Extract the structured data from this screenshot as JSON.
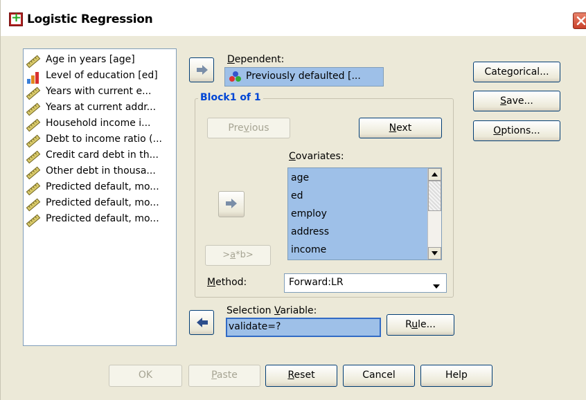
{
  "window": {
    "title": "Logistic Regression"
  },
  "variables": [
    {
      "label": "Age in years [age]",
      "icon": "ruler-icon"
    },
    {
      "label": "Level of education [ed]",
      "icon": "bar-chart-icon"
    },
    {
      "label": "Years with current e...",
      "icon": "ruler-icon"
    },
    {
      "label": "Years at current addr...",
      "icon": "ruler-icon"
    },
    {
      "label": "Household income i...",
      "icon": "ruler-icon"
    },
    {
      "label": "Debt to income ratio (...",
      "icon": "ruler-icon"
    },
    {
      "label": "Credit card debt in th...",
      "icon": "ruler-icon"
    },
    {
      "label": "Other debt in thousa...",
      "icon": "ruler-icon"
    },
    {
      "label": "Predicted default, mo...",
      "icon": "ruler-icon"
    },
    {
      "label": "Predicted default, mo...",
      "icon": "ruler-icon"
    },
    {
      "label": "Predicted default, mo...",
      "icon": "ruler-icon"
    }
  ],
  "dependent": {
    "label_prefix": "D",
    "label_rest": "ependent:",
    "value": "Previously defaulted [..."
  },
  "block": {
    "title": "Block1 of 1",
    "previous_pre": "Pre",
    "previous_u": "v",
    "previous_post": "ious",
    "next_u": "N",
    "next_post": "ext"
  },
  "covariates": {
    "label_u": "C",
    "label_rest": "ovariates:",
    "items": [
      "age",
      "ed",
      "employ",
      "address",
      "income"
    ]
  },
  "interaction": {
    "pre": ">",
    "u": "a",
    "post": "*b>"
  },
  "method": {
    "label_u": "M",
    "label_rest": "ethod:",
    "value": "Forward:LR"
  },
  "selection": {
    "label_pre": "Selection ",
    "label_u": "V",
    "label_rest": "ariable:",
    "value": "validate=?",
    "rule_pre": "R",
    "rule_u": "u",
    "rule_post": "le..."
  },
  "side_buttons": {
    "categorical_pre": "Cate",
    "categorical_u": "g",
    "categorical_post": "orical...",
    "save_u": "S",
    "save_post": "ave...",
    "options_u": "O",
    "options_post": "ptions..."
  },
  "bottom_buttons": {
    "ok": "OK",
    "paste_u": "P",
    "paste_post": "aste",
    "reset_u": "R",
    "reset_post": "eset",
    "cancel": "Cancel",
    "help": "Help"
  }
}
